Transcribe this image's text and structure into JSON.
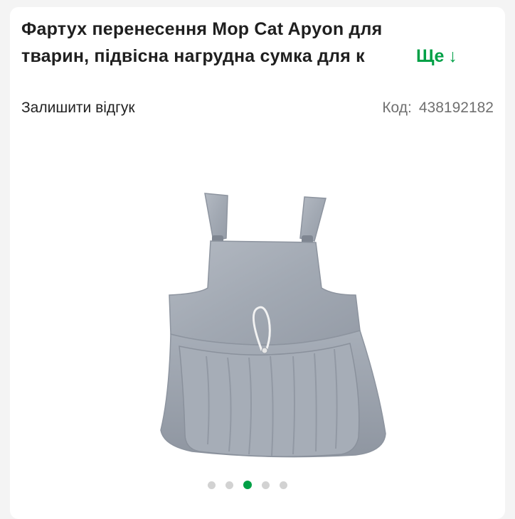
{
  "product": {
    "title_line1": "Фартух перенесення Mop Cat Apyon для",
    "title_line2": "тварин, підвісна нагрудна сумка для к",
    "more_label": "Ще",
    "more_arrow": "↓",
    "review_link": "Залишити відгук",
    "code_label": "Код:",
    "code_value": "438192182"
  },
  "gallery": {
    "image_subject": "grey plush pet-carrier apron",
    "slides": [
      {
        "active": false
      },
      {
        "active": false
      },
      {
        "active": true
      },
      {
        "active": false
      },
      {
        "active": false
      }
    ]
  },
  "colors": {
    "accent": "#00a046",
    "title": "#1f1f1f",
    "muted": "#707070",
    "fabric": "#a9b0ba"
  }
}
